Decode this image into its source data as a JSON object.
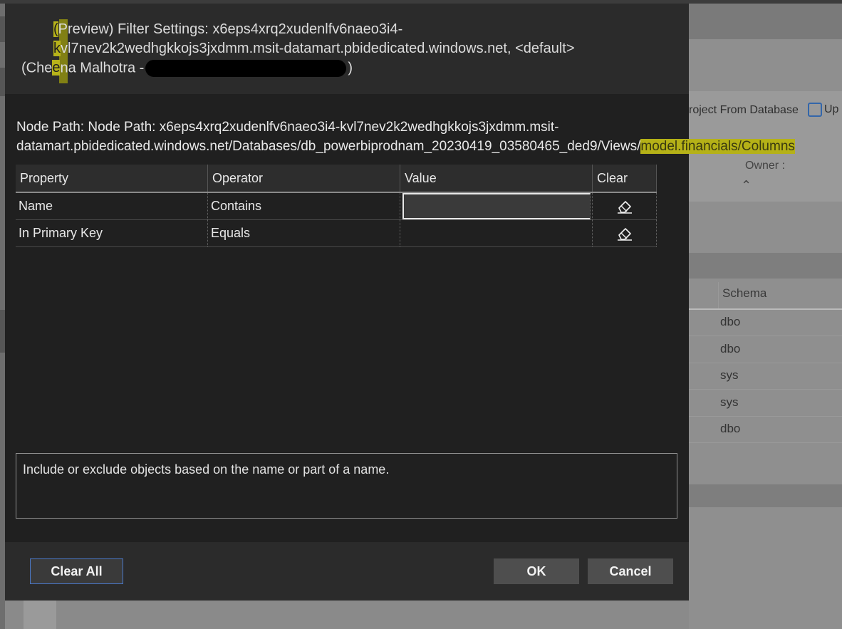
{
  "dialog": {
    "title_line1_prefix": "(",
    "title_line1_text": "Preview) Filter Settings: x6eps4xrq2xudenlfv6naeo3i4-",
    "title_line2_prefix": "k",
    "title_line2_text": "vl7nev2k2wedhgkkojs3jxdmm.msit-datamart.pbidedicated.windows.net, <default>",
    "title_line3_a": "(Che",
    "title_line3_b": "e",
    "title_line3_c": "na Malhotra -",
    "title_line3_end": ")",
    "node_path_line1": "Node Path: Node Path: x6eps4xrq2xudenlfv6naeo3i4-kvl7nev2k2wedhgkkojs3jxdmm.msit-",
    "node_path_line2_a": "datamart.pbidedicated.windows.net/Databases/db_powerbiprodnam_20230419_03580465_ded9/Views/",
    "node_path_line2_b": "model.financials/Columns",
    "description": "Include or exclude objects based on the name or part of a name."
  },
  "grid": {
    "headers": [
      "Property",
      "Operator",
      "Value",
      "Clear"
    ],
    "rows": [
      {
        "property": "Name",
        "operator": "Contains",
        "value": ""
      },
      {
        "property": "In Primary Key",
        "operator": "Equals",
        "value": ""
      }
    ]
  },
  "buttons": {
    "clear_all": "Clear All",
    "ok": "OK",
    "cancel": "Cancel"
  },
  "background": {
    "toolbar_project_from_db": "roject From Database",
    "toolbar_up": "Up",
    "owner_label": "Owner :",
    "schema_header": "Schema",
    "schema_rows": [
      "dbo",
      "dbo",
      "sys",
      "sys",
      "dbo"
    ]
  },
  "colors": {
    "dialog_bg": "#202020",
    "highlight": "#b7b31a",
    "clear_all_border": "#4a78c8"
  }
}
